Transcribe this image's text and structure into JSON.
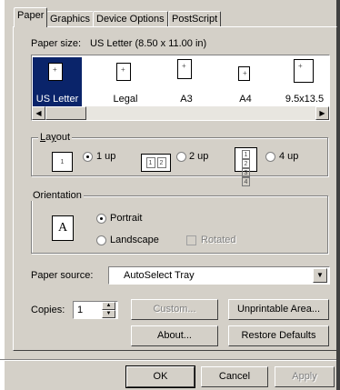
{
  "tabs": [
    {
      "label": "Paper",
      "active": true
    },
    {
      "label": "Graphics"
    },
    {
      "label": "Device Options"
    },
    {
      "label": "PostScript"
    }
  ],
  "paper_size": {
    "label": "Paper size:",
    "value": "US Letter (8.50 x 11.00 in)",
    "items": [
      {
        "label": "US Letter",
        "selected": true
      },
      {
        "label": "Legal"
      },
      {
        "label": "A3"
      },
      {
        "label": "A4"
      },
      {
        "label": "9.5x13.5"
      }
    ]
  },
  "layout": {
    "title": "Layout",
    "options": [
      {
        "label": "1 up",
        "icon_text": "1",
        "selected": true
      },
      {
        "label": "2 up",
        "icon_text": [
          "1",
          "2"
        ]
      },
      {
        "label": "4 up",
        "icon_text": [
          "1",
          "2",
          "3",
          "4"
        ]
      }
    ]
  },
  "orientation": {
    "title": "Orientation",
    "icon_text": "A",
    "portrait": "Portrait",
    "landscape": "Landscape",
    "rotated": "Rotated",
    "selected": "portrait"
  },
  "paper_source": {
    "label": "Paper source:",
    "value": "AutoSelect Tray"
  },
  "copies": {
    "label": "Copies:",
    "value": "1"
  },
  "buttons": {
    "custom": "Custom...",
    "unprintable": "Unprintable Area...",
    "about": "About...",
    "restore": "Restore Defaults",
    "ok": "OK",
    "cancel": "Cancel",
    "apply": "Apply"
  },
  "colors": {
    "selection": "#0a246a",
    "face": "#d4d0c8"
  }
}
